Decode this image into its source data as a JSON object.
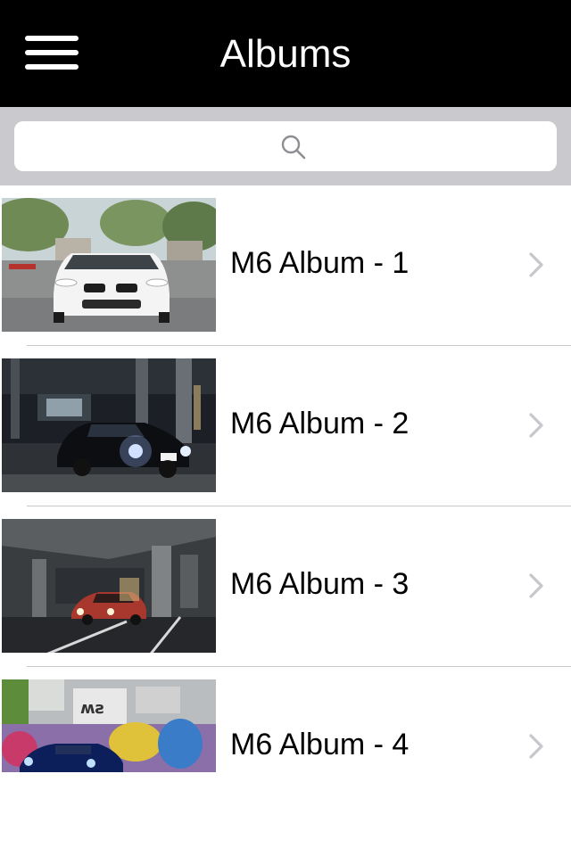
{
  "navbar": {
    "title": "Albums",
    "menu_icon": "hamburger-menu-icon",
    "background": "#000000"
  },
  "search": {
    "placeholder": "",
    "icon": "search-icon"
  },
  "albums": [
    {
      "label": "M6 Album - 1",
      "thumbnail": "white-bmw-m6-front-view"
    },
    {
      "label": "M6 Album - 2",
      "thumbnail": "black-bmw-m6-parking-garage-headlights"
    },
    {
      "label": "M6 Album - 3",
      "thumbnail": "red-bmw-m6-underground-parking"
    },
    {
      "label": "M6 Album - 4",
      "thumbnail": "blue-bmw-m6-graffiti-wall"
    }
  ],
  "colors": {
    "search_bar_bg": "#c9c9ce",
    "separator": "#c8c7cc",
    "chevron": "#c7c7cc"
  }
}
